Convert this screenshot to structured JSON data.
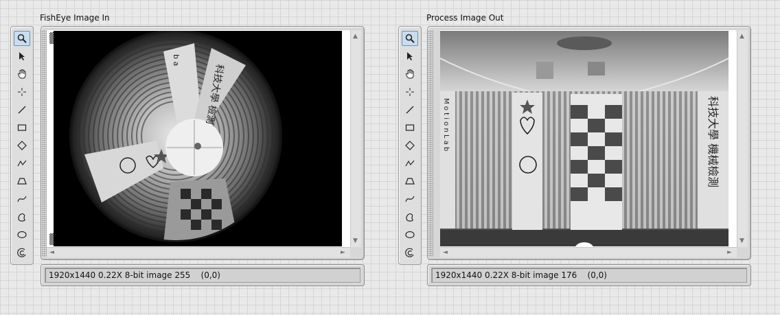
{
  "panels": {
    "left": {
      "title": "FishEye Image In",
      "status": "1920x1440 0.22X 8-bit image 255    (0,0)"
    },
    "right": {
      "title": "Process Image Out",
      "status": "1920x1440 0.22X 8-bit image 176    (0,0)"
    }
  },
  "tools": [
    "zoom-icon",
    "pointer-icon",
    "pan-hand-icon",
    "crosshair-point-icon",
    "line-icon",
    "rectangle-icon",
    "rotated-rectangle-icon",
    "polyline-icon",
    "polygon-icon",
    "freehand-icon",
    "freehand-region-icon",
    "oval-icon",
    "annulus-icon"
  ],
  "images": {
    "left": {
      "sign_letters": "b a",
      "sign_chars": "科技大學 檢測"
    },
    "right": {
      "sign_letters": "M o t i o n L a b",
      "sign_chars": "科技大學 機械檢測"
    }
  },
  "scroll": {
    "up": "▲",
    "down": "▼",
    "left": "◄",
    "right": "►"
  }
}
